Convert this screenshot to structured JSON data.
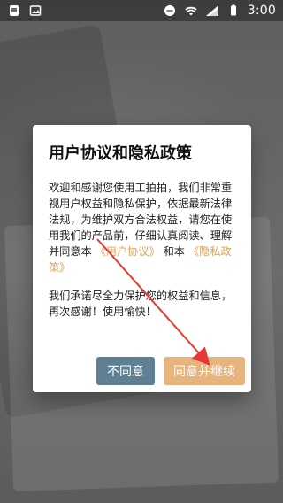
{
  "status_bar": {
    "time": "3:00",
    "left_icons": [
      "sim-icon",
      "image-icon"
    ],
    "right_icons": [
      "minus-circle-icon",
      "wifi-icon",
      "signal-icon",
      "battery-icon"
    ]
  },
  "dialog": {
    "title": "用户协议和隐私政策",
    "paragraph1_prefix": "欢迎和感谢您使用工拍拍，我们非常重视用户权益和隐私保护，依据最新法律法规，为维护双方合法权益，请您在使用我们的产品前，仔细认真阅读、理解并同意本",
    "user_agreement_link": "《用户协议》",
    "paragraph1_middle": "和本",
    "privacy_policy_link": "《隐私政策》",
    "paragraph2": "我们承诺尽全力保护您的权益和信息，再次感谢！使用愉快！",
    "disagree_label": "不同意",
    "agree_label": "同意并继续"
  },
  "colors": {
    "link": "#e0a25a",
    "disagree_button": "#5f7f93",
    "agree_button": "#e7b47e",
    "pointer": "#e53935"
  }
}
